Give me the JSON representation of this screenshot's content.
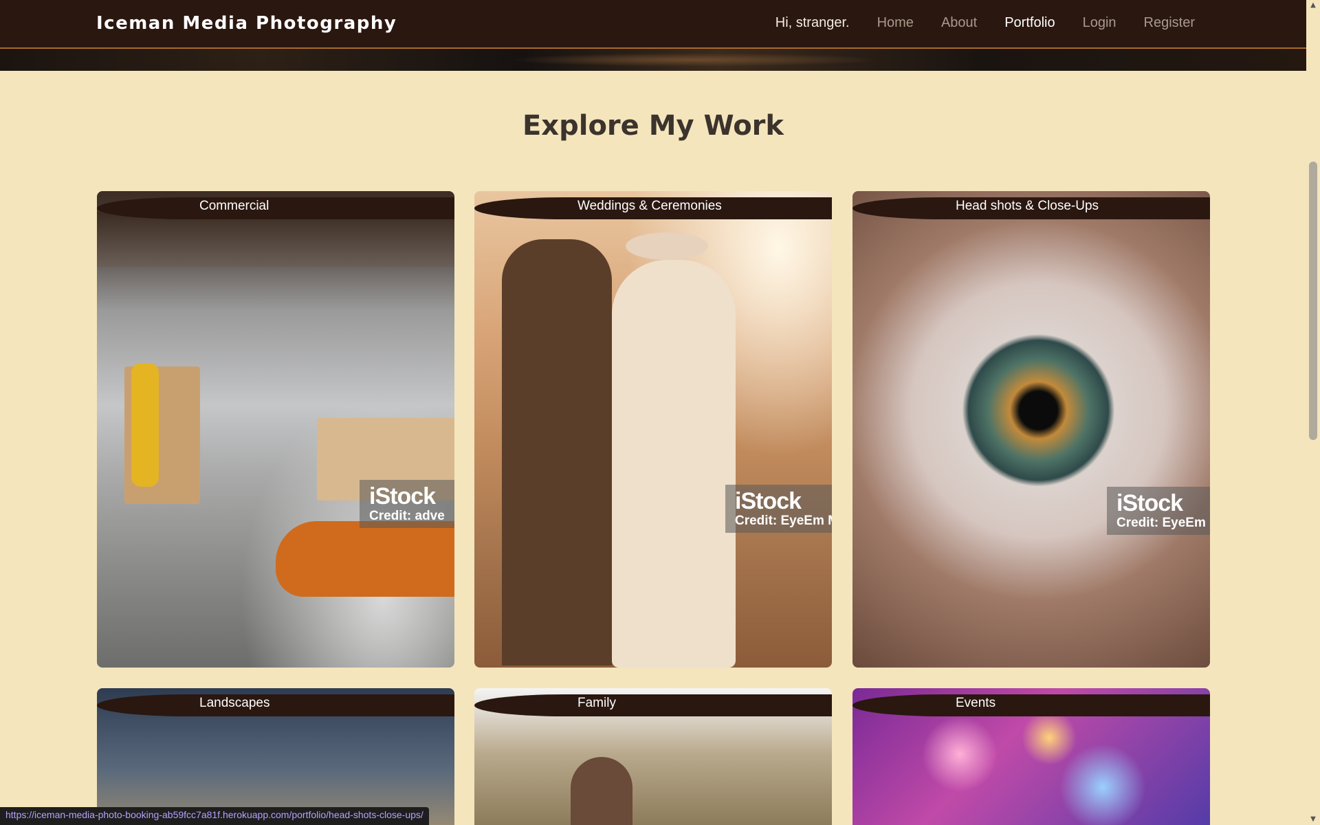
{
  "nav": {
    "brand": "Iceman Media Photography",
    "greeting": "Hi, stranger.",
    "links": [
      "Home",
      "About",
      "Portfolio",
      "Login",
      "Register"
    ]
  },
  "section": {
    "title": "Explore My Work"
  },
  "cards": [
    {
      "label": "Commercial",
      "credit": "Credit: adve"
    },
    {
      "label": "Weddings & Ceremonies",
      "credit": "Credit: EyeEm M"
    },
    {
      "label": "Head shots & Close-Ups",
      "credit": "Credit: EyeEm"
    },
    {
      "label": "Landscapes"
    },
    {
      "label": "Family"
    },
    {
      "label": "Events"
    }
  ],
  "watermark_brand": "iStock",
  "status_url": "https://iceman-media-photo-booking-ab59fcc7a81f.herokuapp.com/portfolio/head-shots-close-ups/",
  "colors": {
    "nav_bg": "#2a1710",
    "page_bg": "#f4e5bd",
    "accent_border": "#a86a2e"
  }
}
